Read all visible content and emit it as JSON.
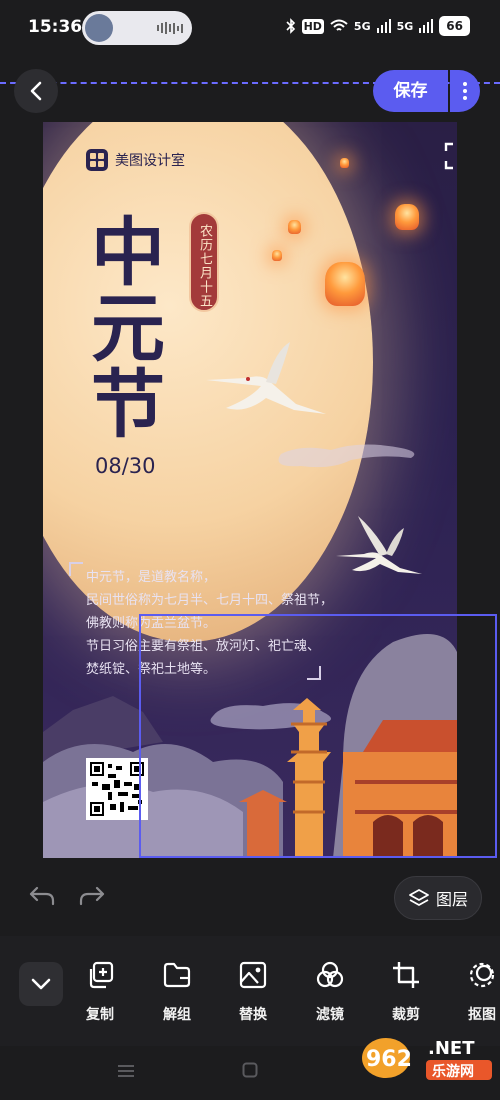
{
  "status_bar": {
    "time": "15:36",
    "network_hd": "HD",
    "network_5g_a": "5G",
    "network_5g_b": "5G",
    "battery": "66"
  },
  "header": {
    "save_label": "保存"
  },
  "poster": {
    "brand": "美图设计室",
    "title_chars": [
      "中",
      "元",
      "节"
    ],
    "date": "08/30",
    "lunar_date": "农历七月十五",
    "poem_lines": [
      "中元节，是道教名称，",
      "民间世俗称为七月半、七月十四、祭祖节，",
      "佛教则称为盂兰盆节。",
      "节日习俗主要有祭祖、放河灯、祀亡魂、",
      "焚纸锭、祭祀土地等。"
    ]
  },
  "bottom": {
    "layers_label": "图层"
  },
  "toolbar": {
    "tools": [
      {
        "label": "复制",
        "icon": "copy-icon"
      },
      {
        "label": "解组",
        "icon": "ungroup-folder-icon"
      },
      {
        "label": "替换",
        "icon": "replace-image-icon"
      },
      {
        "label": "滤镜",
        "icon": "filter-icon"
      },
      {
        "label": "裁剪",
        "icon": "crop-icon"
      },
      {
        "label": "抠图",
        "icon": "cutout-icon"
      }
    ]
  },
  "watermark": {
    "number": "962",
    "suffix": ".NET",
    "site": "乐游网"
  },
  "colors": {
    "accent": "#5b5cf0",
    "background": "#1c1c1e",
    "poster_title": "#2a2350",
    "lunar_badge": "#a33a3a"
  }
}
